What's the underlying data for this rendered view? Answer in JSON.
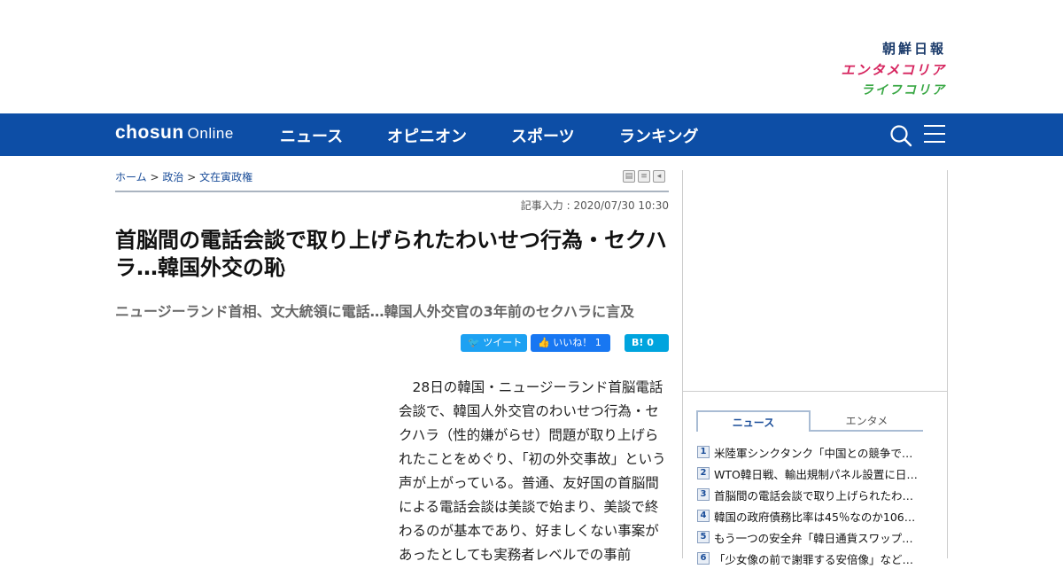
{
  "header": {
    "brand_chosun": "朝鮮日報",
    "brand_entame": "エンタメコリア",
    "brand_life": "ライフコリア"
  },
  "nav": {
    "logo_main": "chosun",
    "logo_sub": "Online",
    "items": [
      "ニュース",
      "オピニオン",
      "スポーツ",
      "ランキング"
    ]
  },
  "breadcrumb": {
    "items": [
      "ホーム",
      "政治",
      "文在寅政権"
    ],
    "separator": ">"
  },
  "article": {
    "date": "記事入力 : 2020/07/30 10:30",
    "title": "首脳間の電話会談で取り上げられたわいせつ行為・セクハラ…韓国外交の恥",
    "subtitle": "ニュージーランド首相、文大統領に電話…韓国人外交官の3年前のセクハラに言及",
    "body": "28日の韓国・ニュージーランド首脳電話会談で、韓国人外交官のわいせつ行為・セクハラ（性的嫌がらせ）問題が取り上げられたことをめぐり、「初の外交事故」という声が上がっている。普通、友好国の首脳間による電話会談は美談で始まり、美談で終わるのが基本であり、好ましくない事案があったとしても実務者レベルでの事前"
  },
  "social": {
    "tweet": "ツイート",
    "like": "いいね！ 1",
    "hatena": "B! 0"
  },
  "sidebar": {
    "tabs": [
      "ニュース",
      "エンタメ"
    ],
    "ranking": [
      {
        "num": "1",
        "text": "米陸軍シンクタンク「中国との競争で…"
      },
      {
        "num": "2",
        "text": "WTO韓日戦、輸出規制パネル設置に日…"
      },
      {
        "num": "3",
        "text": "首脳間の電話会談で取り上げられたわ…"
      },
      {
        "num": "4",
        "text": "韓国の政府債務比率は45％なのか106…"
      },
      {
        "num": "5",
        "text": "もう一つの安全弁「韓日通貨スワップ…"
      },
      {
        "num": "6",
        "text": "「少女像の前で謝罪する安倍像」など…"
      }
    ]
  },
  "colors": {
    "nav_bg": "#0d4ea6",
    "link": "#1a4d99",
    "entame": "#d6245e",
    "life": "#3aa845"
  }
}
